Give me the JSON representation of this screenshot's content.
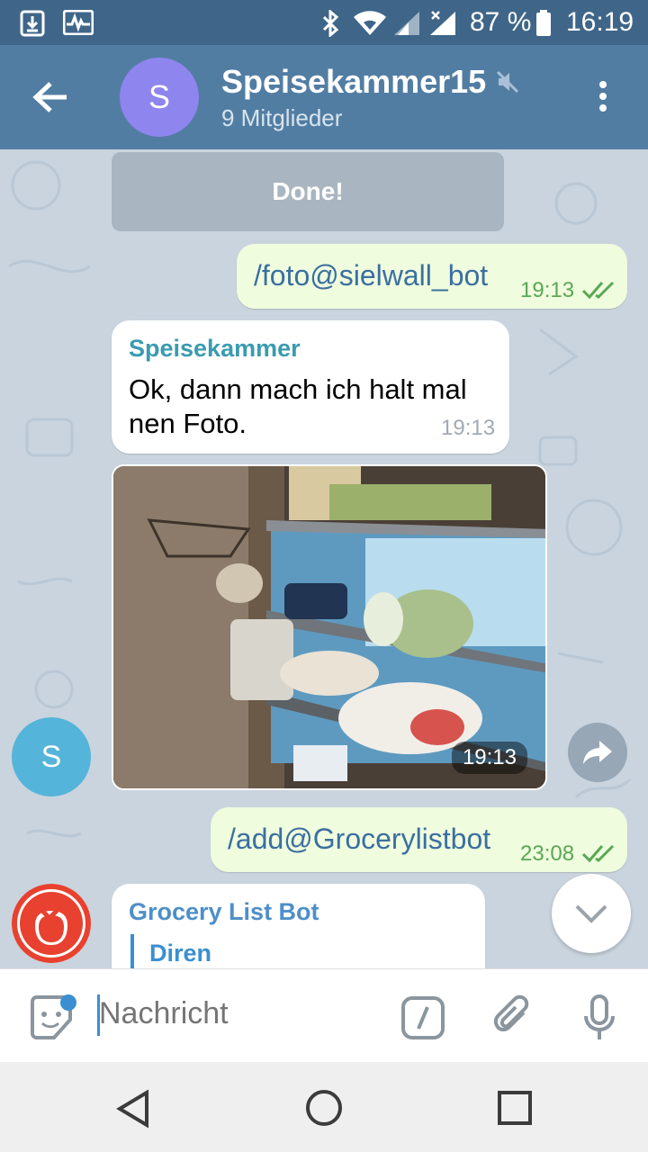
{
  "status_bar": {
    "battery": "87 %",
    "time": "16:19",
    "icons": [
      "download-icon",
      "activity-icon",
      "bluetooth-icon",
      "wifi-icon",
      "signal-icon",
      "signal-off-icon",
      "battery-icon"
    ]
  },
  "header": {
    "avatar_letter": "S",
    "title": "Speisekammer15",
    "subtitle": "9 Mitglieder",
    "muted": true
  },
  "messages": [
    {
      "type": "button",
      "label": "Done!"
    },
    {
      "type": "outgoing",
      "text": "/foto@sielwall_bot",
      "time": "19:13",
      "read": true
    },
    {
      "type": "incoming",
      "sender": "Speisekammer",
      "text_line1": "Ok, dann mach ich halt mal",
      "text_line2": "nen Foto.",
      "time": "19:13"
    },
    {
      "type": "photo",
      "time": "19:13",
      "sender_avatar": "S"
    },
    {
      "type": "outgoing",
      "text": "/add@Grocerylistbot",
      "time": "23:08",
      "read": true
    },
    {
      "type": "incoming",
      "sender": "Grocery List Bot",
      "reply_name": "Diren"
    }
  ],
  "input": {
    "placeholder": "Nachricht"
  },
  "colors": {
    "appbar": "#527da3",
    "statusbar": "#3f6689",
    "outgoing_bubble": "#effdde",
    "accent": "#3b8fd0"
  }
}
